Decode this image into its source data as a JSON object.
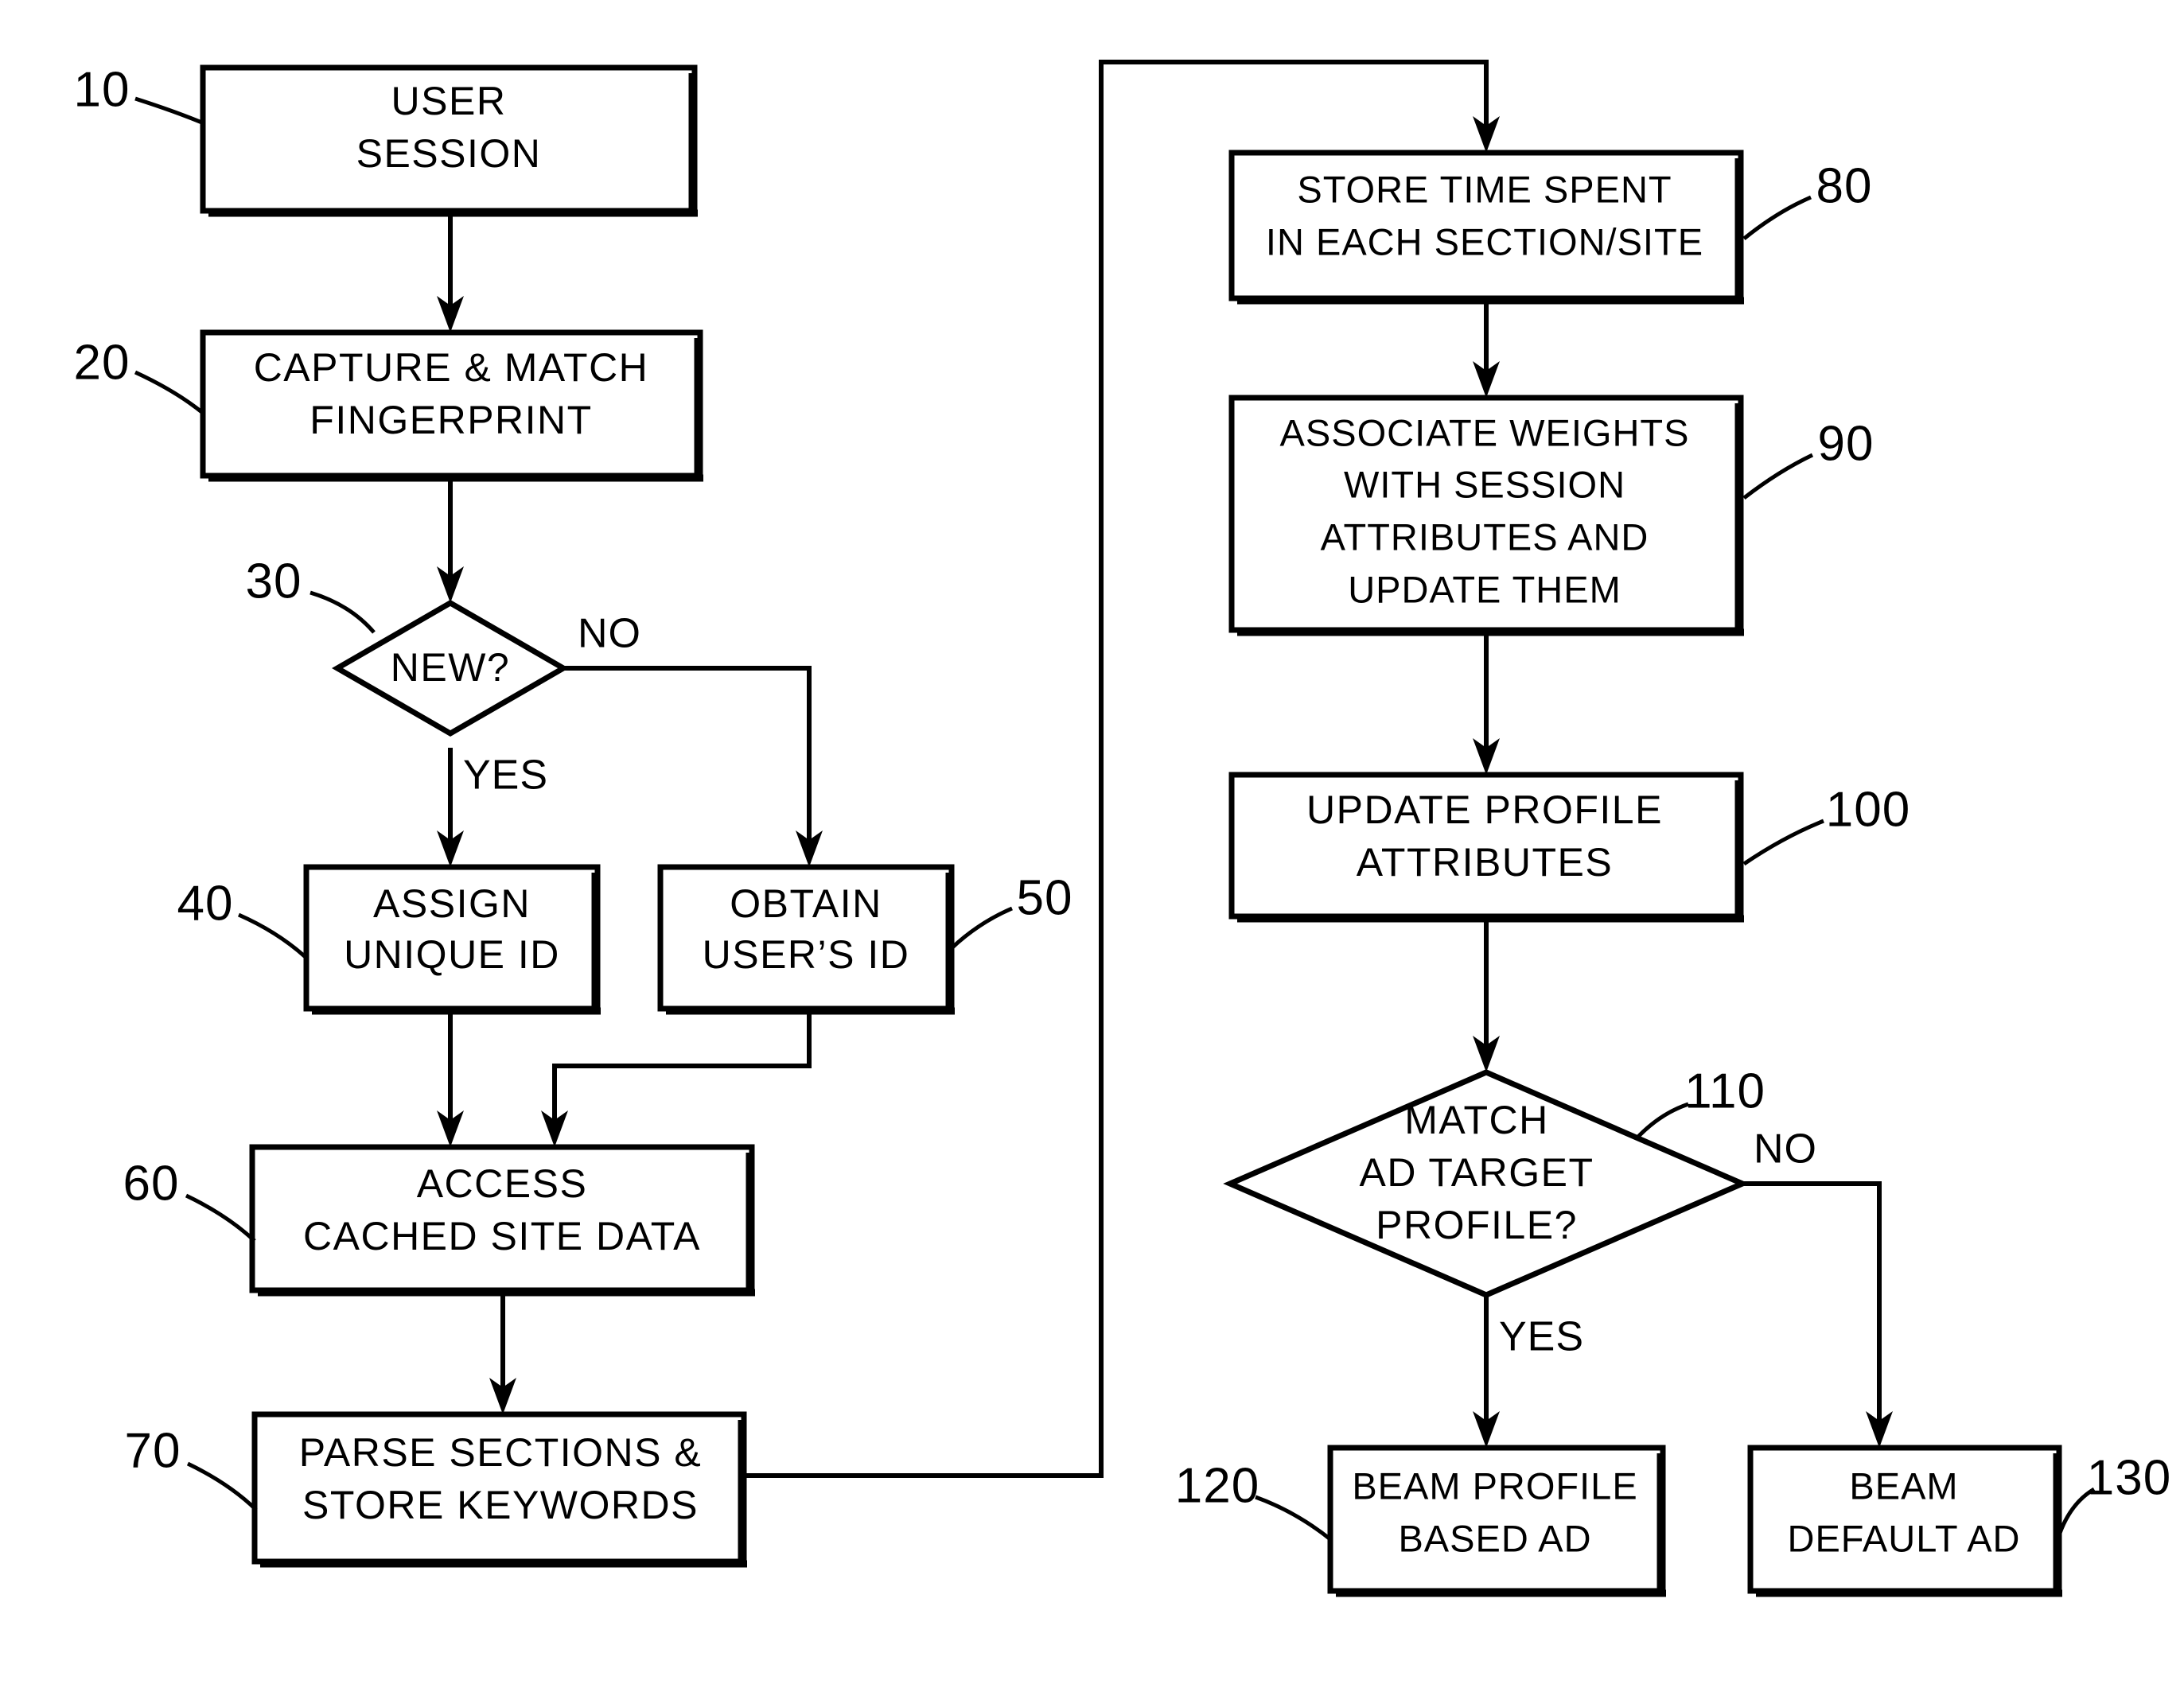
{
  "diagram": {
    "title": "User session ad targeting flowchart",
    "background_color": "#ffffff",
    "line_color": "#000000"
  },
  "nodes": [
    {
      "id": "10",
      "ref": "10",
      "shape": "process",
      "lines": [
        "USER",
        "SESSION"
      ]
    },
    {
      "id": "20",
      "ref": "20",
      "shape": "process",
      "lines": [
        "CAPTURE  &  MATCH",
        "FINGERPRINT"
      ]
    },
    {
      "id": "30",
      "ref": "30",
      "shape": "decision",
      "lines": [
        "NEW?"
      ]
    },
    {
      "id": "40",
      "ref": "40",
      "shape": "process",
      "lines": [
        "ASSIGN",
        "UNIQUE  ID"
      ]
    },
    {
      "id": "50",
      "ref": "50",
      "shape": "process",
      "lines": [
        "OBTAIN",
        "USER’S  ID"
      ]
    },
    {
      "id": "60",
      "ref": "60",
      "shape": "process",
      "lines": [
        "ACCESS",
        "CACHED  SITE  DATA"
      ]
    },
    {
      "id": "70",
      "ref": "70",
      "shape": "process",
      "lines": [
        "PARSE  SECTIONS  &",
        "STORE  KEYWORDS"
      ]
    },
    {
      "id": "80",
      "ref": "80",
      "shape": "process",
      "lines": [
        "STORE TIME SPENT",
        "IN EACH SECTION/SITE"
      ]
    },
    {
      "id": "90",
      "ref": "90",
      "shape": "process",
      "lines": [
        "ASSOCIATE  WEIGHTS",
        "WITH  SESSION",
        "ATTRIBUTES  AND",
        "UPDATE  THEM"
      ]
    },
    {
      "id": "100",
      "ref": "100",
      "shape": "process",
      "lines": [
        "UPDATE  PROFILE",
        "ATTRIBUTES"
      ]
    },
    {
      "id": "110",
      "ref": "110",
      "shape": "decision",
      "lines": [
        "MATCH",
        "AD  TARGET",
        "PROFILE?"
      ]
    },
    {
      "id": "120",
      "ref": "120",
      "shape": "process",
      "lines": [
        "BEAM PROFILE",
        "BASED AD"
      ]
    },
    {
      "id": "130",
      "ref": "130",
      "shape": "process",
      "lines": [
        "BEAM",
        "DEFAULT AD"
      ]
    }
  ],
  "edge_labels": {
    "new_no": "NO",
    "new_yes": "YES",
    "match_no": "NO",
    "match_yes": "YES"
  },
  "node_text": {
    "n10_l1": "USER",
    "n10_l2": "SESSION",
    "n20_l1": "CAPTURE  &  MATCH",
    "n20_l2": "FINGERPRINT",
    "n30_l1": "NEW?",
    "n40_l1": "ASSIGN",
    "n40_l2": "UNIQUE  ID",
    "n50_l1": "OBTAIN",
    "n50_l2": "USER’S  ID",
    "n60_l1": "ACCESS",
    "n60_l2": "CACHED  SITE  DATA",
    "n70_l1": "PARSE  SECTIONS  &",
    "n70_l2": "STORE  KEYWORDS",
    "n80_l1": "STORE TIME SPENT",
    "n80_l2": "IN EACH SECTION/SITE",
    "n90_l1": "ASSOCIATE  WEIGHTS",
    "n90_l2": "WITH  SESSION",
    "n90_l3": "ATTRIBUTES  AND",
    "n90_l4": "UPDATE  THEM",
    "n100_l1": "UPDATE  PROFILE",
    "n100_l2": "ATTRIBUTES",
    "n110_l1": "MATCH",
    "n110_l2": "AD  TARGET",
    "n110_l3": "PROFILE?",
    "n120_l1": "BEAM PROFILE",
    "n120_l2": "BASED AD",
    "n130_l1": "BEAM",
    "n130_l2": "DEFAULT AD"
  },
  "ref_numbers": {
    "r10": "10",
    "r20": "20",
    "r30": "30",
    "r40": "40",
    "r50": "50",
    "r60": "60",
    "r70": "70",
    "r80": "80",
    "r90": "90",
    "r100": "100",
    "r110": "110",
    "r120": "120",
    "r130": "130"
  }
}
